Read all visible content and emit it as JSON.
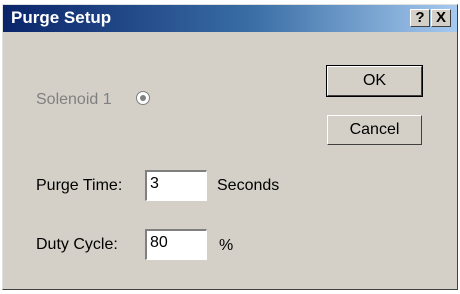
{
  "window": {
    "title": "Purge Setup",
    "help_button": "?",
    "close_button": "X"
  },
  "solenoid": {
    "label": "Solenoid 1",
    "selected": true,
    "enabled": false
  },
  "buttons": {
    "ok_label": "OK",
    "cancel_label": "Cancel"
  },
  "purge_time": {
    "label": "Purge Time:",
    "value": "3",
    "unit": "Seconds"
  },
  "duty_cycle": {
    "label": "Duty Cycle:",
    "value": "80",
    "unit": "%"
  }
}
